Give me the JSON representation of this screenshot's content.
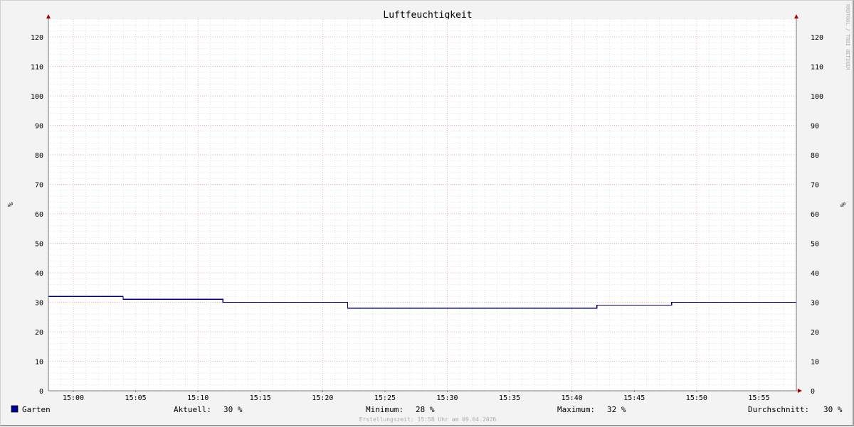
{
  "chart_data": {
    "type": "line",
    "title": "Luftfeuchtigkeit",
    "ylabel_left": "%",
    "ylabel_right": "%",
    "ylim": [
      0,
      126
    ],
    "yticks": [
      0,
      10,
      20,
      30,
      40,
      50,
      60,
      70,
      80,
      90,
      100,
      110,
      120
    ],
    "xlim": [
      "14:58",
      "15:58"
    ],
    "xticks": [
      "15:00",
      "15:05",
      "15:10",
      "15:15",
      "15:20",
      "15:25",
      "15:30",
      "15:35",
      "15:40",
      "15:45",
      "15:50",
      "15:55"
    ],
    "grid": true,
    "series": [
      {
        "name": "Garten",
        "color": "#000080",
        "step": true,
        "points": [
          {
            "x": "14:58",
            "y": 32
          },
          {
            "x": "15:04",
            "y": 31
          },
          {
            "x": "15:12",
            "y": 30
          },
          {
            "x": "15:22",
            "y": 28
          },
          {
            "x": "15:42",
            "y": 29
          },
          {
            "x": "15:48",
            "y": 30
          },
          {
            "x": "15:58",
            "y": 30
          }
        ]
      }
    ],
    "legend": {
      "position": "bottom",
      "swatch_color": "#000099",
      "name": "Garten",
      "current_label": "Aktuell:",
      "current_value": "30 %",
      "min_label": "Minimum:",
      "min_value": "28 %",
      "max_label": "Maximum:",
      "max_value": "32 %",
      "avg_label": "Durchschnitt:",
      "avg_value": "30 %"
    },
    "credit": "RRDTOOL / TOBI OETIKER",
    "footer": "Erstellungszeit: 15:58 Uhr am 09.04.2026"
  },
  "colors": {
    "background": "#f3f3f3",
    "canvas": "#ffffff",
    "major_grid": "#f0a0a0",
    "minor_grid": "#d0d0d0",
    "axis": "#777777",
    "arrow": "#aa0000"
  }
}
